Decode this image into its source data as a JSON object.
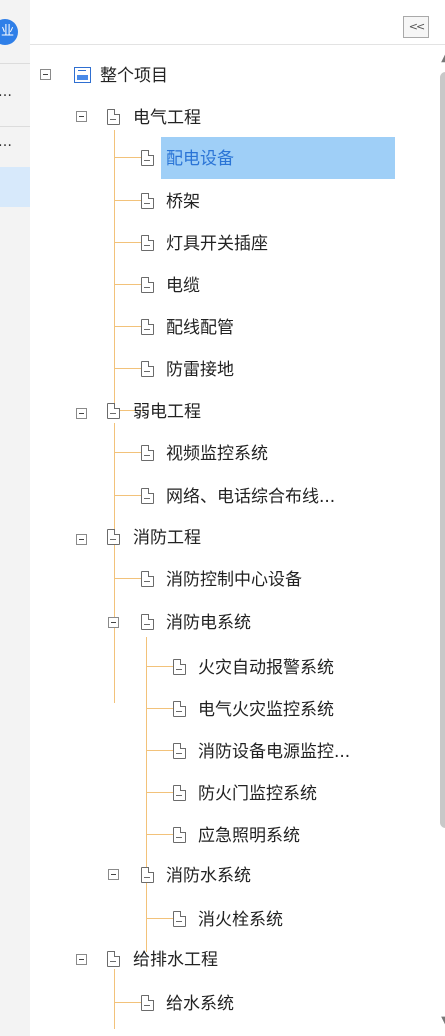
{
  "left_strip": {
    "icon_char": "业"
  },
  "tree": {
    "root": "整个项目",
    "groups": [
      {
        "label": "电气工程",
        "children": [
          "配电设备",
          "桥架",
          "灯具开关插座",
          "电缆",
          "配线配管",
          "防雷接地"
        ]
      },
      {
        "label": "弱电工程",
        "children": [
          "视频监控系统",
          "网络、电话综合布线..."
        ]
      },
      {
        "label": "消防工程",
        "children": [
          "消防控制中心设备"
        ],
        "subgroups": [
          {
            "label": "消防电系统",
            "children": [
              "火灾自动报警系统",
              "电气火灾监控系统",
              "消防设备电源监控...",
              "防火门监控系统",
              "应急照明系统"
            ]
          },
          {
            "label": "消防水系统",
            "children": [
              "消火栓系统"
            ]
          }
        ]
      },
      {
        "label": "给排水工程",
        "children": [
          "给水系统"
        ]
      }
    ],
    "selected": "配电设备"
  },
  "colors": {
    "selection": "#9fcff7",
    "connector": "#f2c27a",
    "selected_text": "#2a74d6"
  },
  "icons": {
    "collapse": "collapse-left-icon",
    "node": "document-icon",
    "root": "project-icon"
  }
}
